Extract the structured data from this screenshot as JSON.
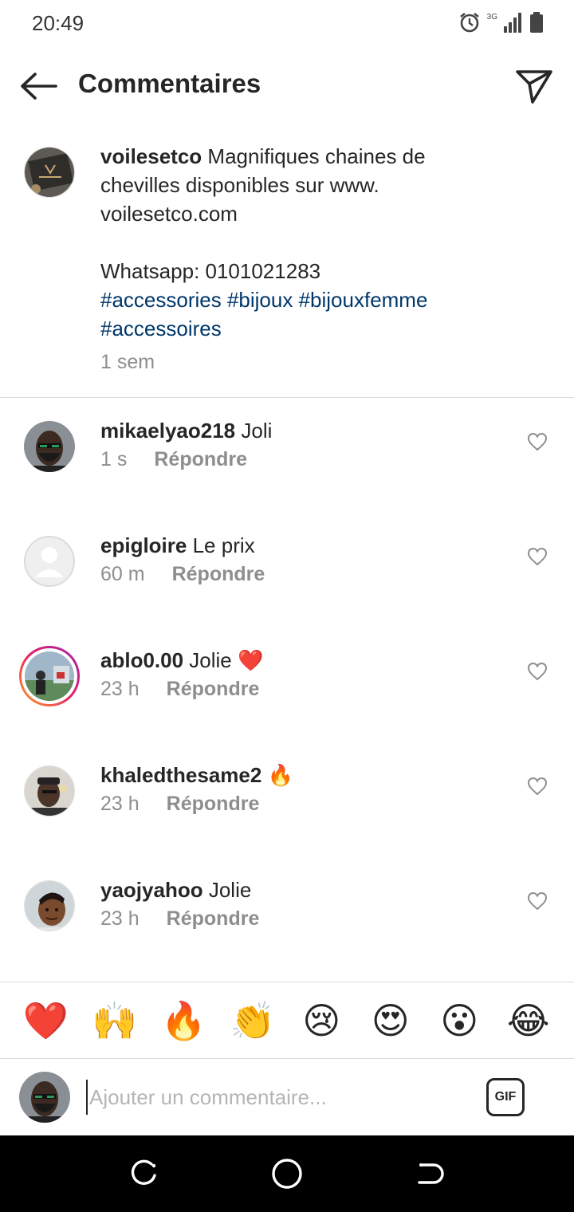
{
  "status": {
    "time": "20:49",
    "network": "3G"
  },
  "header": {
    "title": "Commentaires"
  },
  "caption": {
    "username": "voilesetco",
    "text_line1": "Magnifiques chaines de",
    "text_line2": "chevilles disponibles sur www.",
    "text_line3": "voilesetco.com",
    "whatsapp": "Whatsapp: 0101021283",
    "hashtags_line1": "#accessories #bijoux #bijouxfemme",
    "hashtags_line2": "#accessoires",
    "time": "1 sem"
  },
  "comments": [
    {
      "username": "mikaelyao218",
      "text": "Joli",
      "time": "1 s",
      "reply_label": "Répondre"
    },
    {
      "username": "epigloire",
      "text": "Le prix",
      "time": "60 m",
      "reply_label": "Répondre"
    },
    {
      "username": "ablo0.00",
      "text": "Jolie ❤️",
      "time": "23 h",
      "reply_label": "Répondre"
    },
    {
      "username": "khaledthesame2",
      "text": "🔥",
      "time": "23 h",
      "reply_label": "Répondre"
    },
    {
      "username": "yaojyahoo",
      "text": "Jolie",
      "time": "23 h",
      "reply_label": "Répondre"
    }
  ],
  "emoji_bar": [
    "❤️",
    "🙌",
    "🔥",
    "👏",
    "😢",
    "😍",
    "😮",
    "😂"
  ],
  "input": {
    "placeholder": "Ajouter un commentaire...",
    "gif_label": "GIF"
  },
  "colors": {
    "hashtag": "#00376b",
    "secondary_text": "#8e8e8e",
    "story_ring_start": "#f9a825",
    "story_ring_end": "#c2185b"
  }
}
